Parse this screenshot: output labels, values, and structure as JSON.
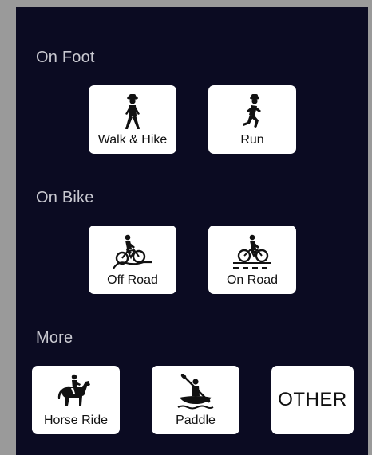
{
  "sections": [
    {
      "title": "On Foot",
      "items": [
        {
          "label": "Walk & Hike",
          "icon": "hiker-icon"
        },
        {
          "label": "Run",
          "icon": "runner-icon"
        }
      ]
    },
    {
      "title": "On Bike",
      "items": [
        {
          "label": "Off Road",
          "icon": "mountain-bike-icon"
        },
        {
          "label": "On Road",
          "icon": "road-bike-icon"
        }
      ]
    },
    {
      "title": "More",
      "items": [
        {
          "label": "Horse Ride",
          "icon": "horse-rider-icon"
        },
        {
          "label": "Paddle",
          "icon": "kayak-icon"
        },
        {
          "label": "OTHER"
        }
      ]
    }
  ],
  "colors": {
    "panel_background": "#0b0b22",
    "tile_background": "#ffffff",
    "section_title": "#c9c9d1"
  }
}
